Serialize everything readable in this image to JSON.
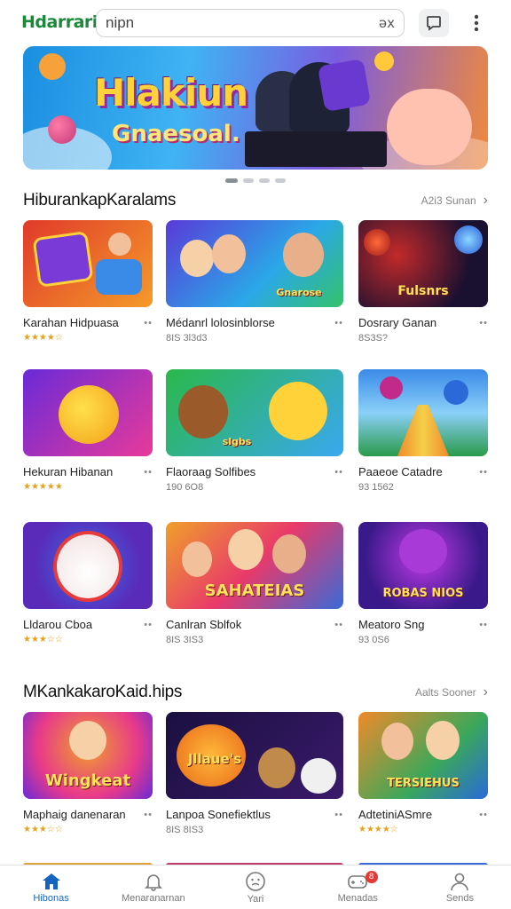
{
  "app": {
    "logo_text": "Hdarrari"
  },
  "search": {
    "value": "nipn",
    "clear_label": "əx"
  },
  "banner": {
    "title": "Hlakiun",
    "subtitle": "Gnaesoal."
  },
  "sections": [
    {
      "title": "HiburankapKaralams",
      "more_label": "A2i3 Sunan",
      "cards": [
        {
          "name": "Karahan Hidpuasa",
          "meta": "★★★★☆",
          "thumb_label": ""
        },
        {
          "name": "Médanrl lolosinblorse",
          "meta": "8IS 3l3d3",
          "thumb_label": "Gnarose"
        },
        {
          "name": "Dosrary Ganan",
          "meta": "8S3S?",
          "thumb_label": "Fulsnrs"
        },
        {
          "name": "Hekuran Hibanan",
          "meta": "★★★★★",
          "thumb_label": ""
        },
        {
          "name": "Flaoraag Solfibes",
          "meta": "190 6O8",
          "thumb_label": "slgbs"
        },
        {
          "name": "Paaeoe Catadre",
          "meta": "93 1562",
          "thumb_label": ""
        },
        {
          "name": "Lldarou Cboa",
          "meta": "★★★☆☆",
          "thumb_label": ""
        },
        {
          "name": "Canlran Sblfok",
          "meta": "8IS 3IS3",
          "thumb_label": "SAHATEIAS"
        },
        {
          "name": "Meatoro Sng",
          "meta": "93 0S6",
          "thumb_label": "ROBAS NIOS"
        }
      ]
    },
    {
      "title": "MKankakaroKaid.hips",
      "more_label": "Aalts Sooner",
      "cards": [
        {
          "name": "Maphaig danenaran",
          "meta": "★★★☆☆",
          "thumb_label": "Wingkeat"
        },
        {
          "name": "Lanpoa Sonefiektlus",
          "meta": "8IS 8IS3",
          "thumb_label": "Jllaue's"
        },
        {
          "name": "AdtetiniASmre",
          "meta": "★★★★☆",
          "thumb_label": "TERSIEHUS"
        }
      ]
    }
  ],
  "bottom_nav": [
    {
      "label": "Hibonas",
      "icon": "home-icon",
      "active": true
    },
    {
      "label": "Menaranarnan",
      "icon": "bell-icon",
      "active": false
    },
    {
      "label": "Yari",
      "icon": "face-icon",
      "active": false
    },
    {
      "label": "Menadas",
      "icon": "gamepad-icon",
      "active": false,
      "badge": "8"
    },
    {
      "label": "Sends",
      "icon": "person-icon",
      "active": false
    }
  ],
  "colors": {
    "accent": "#1565c0",
    "logo": "#1a8a3a",
    "star": "#e5a31a",
    "badge": "#e53935"
  }
}
